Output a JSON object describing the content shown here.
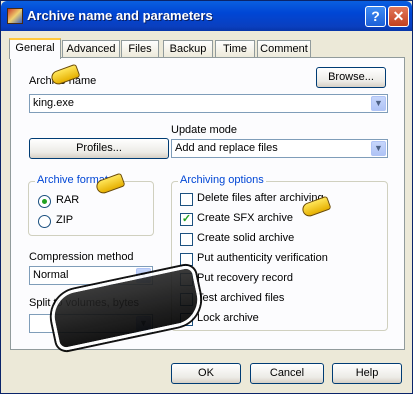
{
  "window": {
    "title": "Archive name and parameters",
    "help_glyph": "?",
    "close_glyph": "✕"
  },
  "tabs": [
    "General",
    "Advanced",
    "Files",
    "Backup",
    "Time",
    "Comment"
  ],
  "archive_name": {
    "label": "Archive name",
    "value": "king.exe",
    "browse_label": "Browse..."
  },
  "profiles_label": "Profiles...",
  "update_mode": {
    "label": "Update mode",
    "value": "Add and replace files"
  },
  "archive_format": {
    "title": "Archive format",
    "options": [
      "RAR",
      "ZIP"
    ],
    "selected": "RAR"
  },
  "archiving_options": {
    "title": "Archiving options",
    "items": [
      {
        "label": "Delete files after archiving",
        "checked": false
      },
      {
        "label": "Create SFX archive",
        "checked": true
      },
      {
        "label": "Create solid archive",
        "checked": false
      },
      {
        "label": "Put authenticity verification",
        "checked": false
      },
      {
        "label": "Put recovery record",
        "checked": false
      },
      {
        "label": "Test archived files",
        "checked": false
      },
      {
        "label": "Lock archive",
        "checked": false
      }
    ]
  },
  "compression": {
    "label": "Compression method",
    "value": "Normal"
  },
  "split": {
    "label": "Split to volumes, bytes",
    "value": ""
  },
  "buttons": {
    "ok": "OK",
    "cancel": "Cancel",
    "help": "Help"
  },
  "icons": {
    "arrow": "chevron-down-icon",
    "check": "✓"
  }
}
